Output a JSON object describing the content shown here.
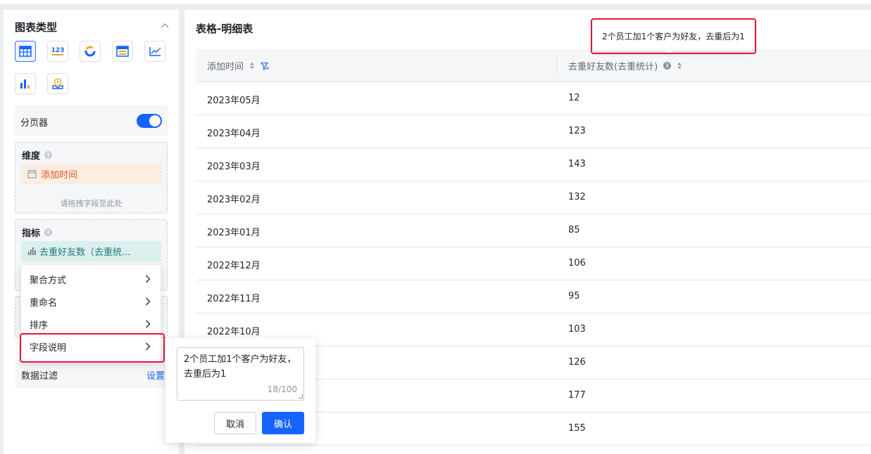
{
  "colors": {
    "primary": "#1664ff",
    "highlight_border": "#e4163b",
    "dimension_text": "#e2541c",
    "dimension_bg": "#fbeee1",
    "indicator_text": "#1f7a78",
    "indicator_bg": "#dcefef"
  },
  "left_panel": {
    "title": "图表类型",
    "chart_types": [
      {
        "icon": "table-chart-icon",
        "active": true
      },
      {
        "icon": "number-card-icon",
        "label": "123"
      },
      {
        "icon": "donut-chart-icon"
      },
      {
        "icon": "detail-table-icon"
      },
      {
        "icon": "line-chart-icon"
      },
      {
        "icon": "bar-chart-icon"
      },
      {
        "icon": "map-chart-icon"
      }
    ],
    "pager": {
      "label": "分页器",
      "enabled": true
    },
    "dimension": {
      "title": "维度",
      "field": "添加时间",
      "drop_hint": "请拖拽字段至此处"
    },
    "indicator": {
      "title": "指标",
      "field": "去重好友数（去重统..."
    },
    "filter": {
      "label": "数据过滤",
      "action": "设置"
    }
  },
  "context_menu": {
    "items": [
      "聚合方式",
      "重命名",
      "排序",
      "字段说明"
    ]
  },
  "field_desc_popover": {
    "text": "2个员工加1个客户为好友，去重后为1",
    "counter": "18/100",
    "cancel": "取消",
    "confirm": "确认"
  },
  "right_panel": {
    "title": "表格-明细表",
    "columns": [
      "添加时间",
      "去重好友数(去重统计)"
    ],
    "rows": [
      [
        "2023年05月",
        "12"
      ],
      [
        "2023年04月",
        "123"
      ],
      [
        "2023年03月",
        "143"
      ],
      [
        "2023年02月",
        "132"
      ],
      [
        "2023年01月",
        "85"
      ],
      [
        "2022年12月",
        "106"
      ],
      [
        "2022年11月",
        "95"
      ],
      [
        "2022年10月",
        "103"
      ],
      [
        "",
        "126"
      ],
      [
        "",
        "177"
      ],
      [
        "",
        "155"
      ]
    ],
    "tooltip": "2个员工加1个客户为好友，去重后为1"
  }
}
